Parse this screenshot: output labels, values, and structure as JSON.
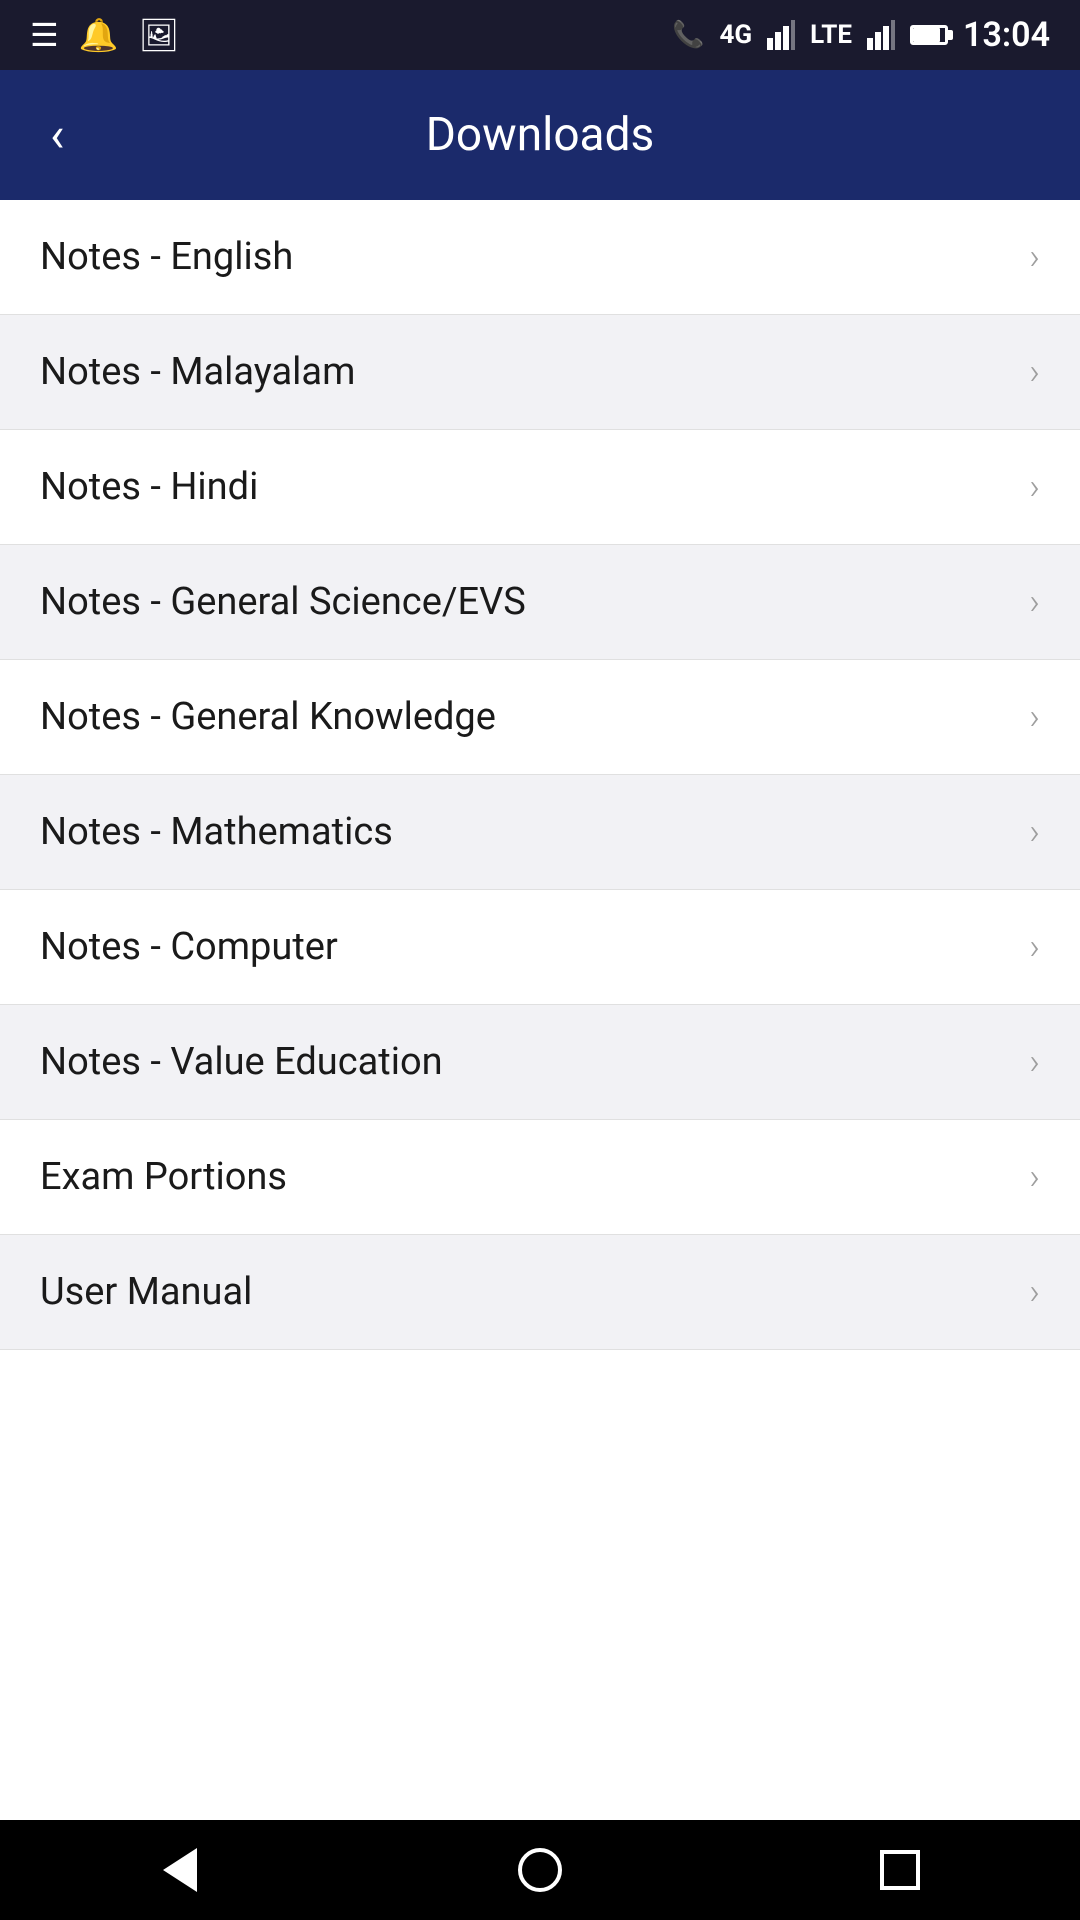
{
  "statusBar": {
    "time": "13:04",
    "icons": [
      "notification-icon",
      "alarm-icon",
      "image-icon",
      "signal-4g-icon",
      "lte-icon",
      "battery-icon"
    ]
  },
  "header": {
    "title": "Downloads",
    "backLabel": "<"
  },
  "listItems": [
    {
      "id": 1,
      "label": "Notes - English"
    },
    {
      "id": 2,
      "label": "Notes - Malayalam"
    },
    {
      "id": 3,
      "label": "Notes - Hindi"
    },
    {
      "id": 4,
      "label": "Notes - General Science/EVS"
    },
    {
      "id": 5,
      "label": "Notes - General Knowledge"
    },
    {
      "id": 6,
      "label": "Notes - Mathematics"
    },
    {
      "id": 7,
      "label": "Notes - Computer"
    },
    {
      "id": 8,
      "label": "Notes - Value Education"
    },
    {
      "id": 9,
      "label": "Exam Portions"
    },
    {
      "id": 10,
      "label": "User Manual"
    }
  ],
  "bottomNav": {
    "back": "back-nav",
    "home": "home-nav",
    "recents": "recents-nav"
  }
}
